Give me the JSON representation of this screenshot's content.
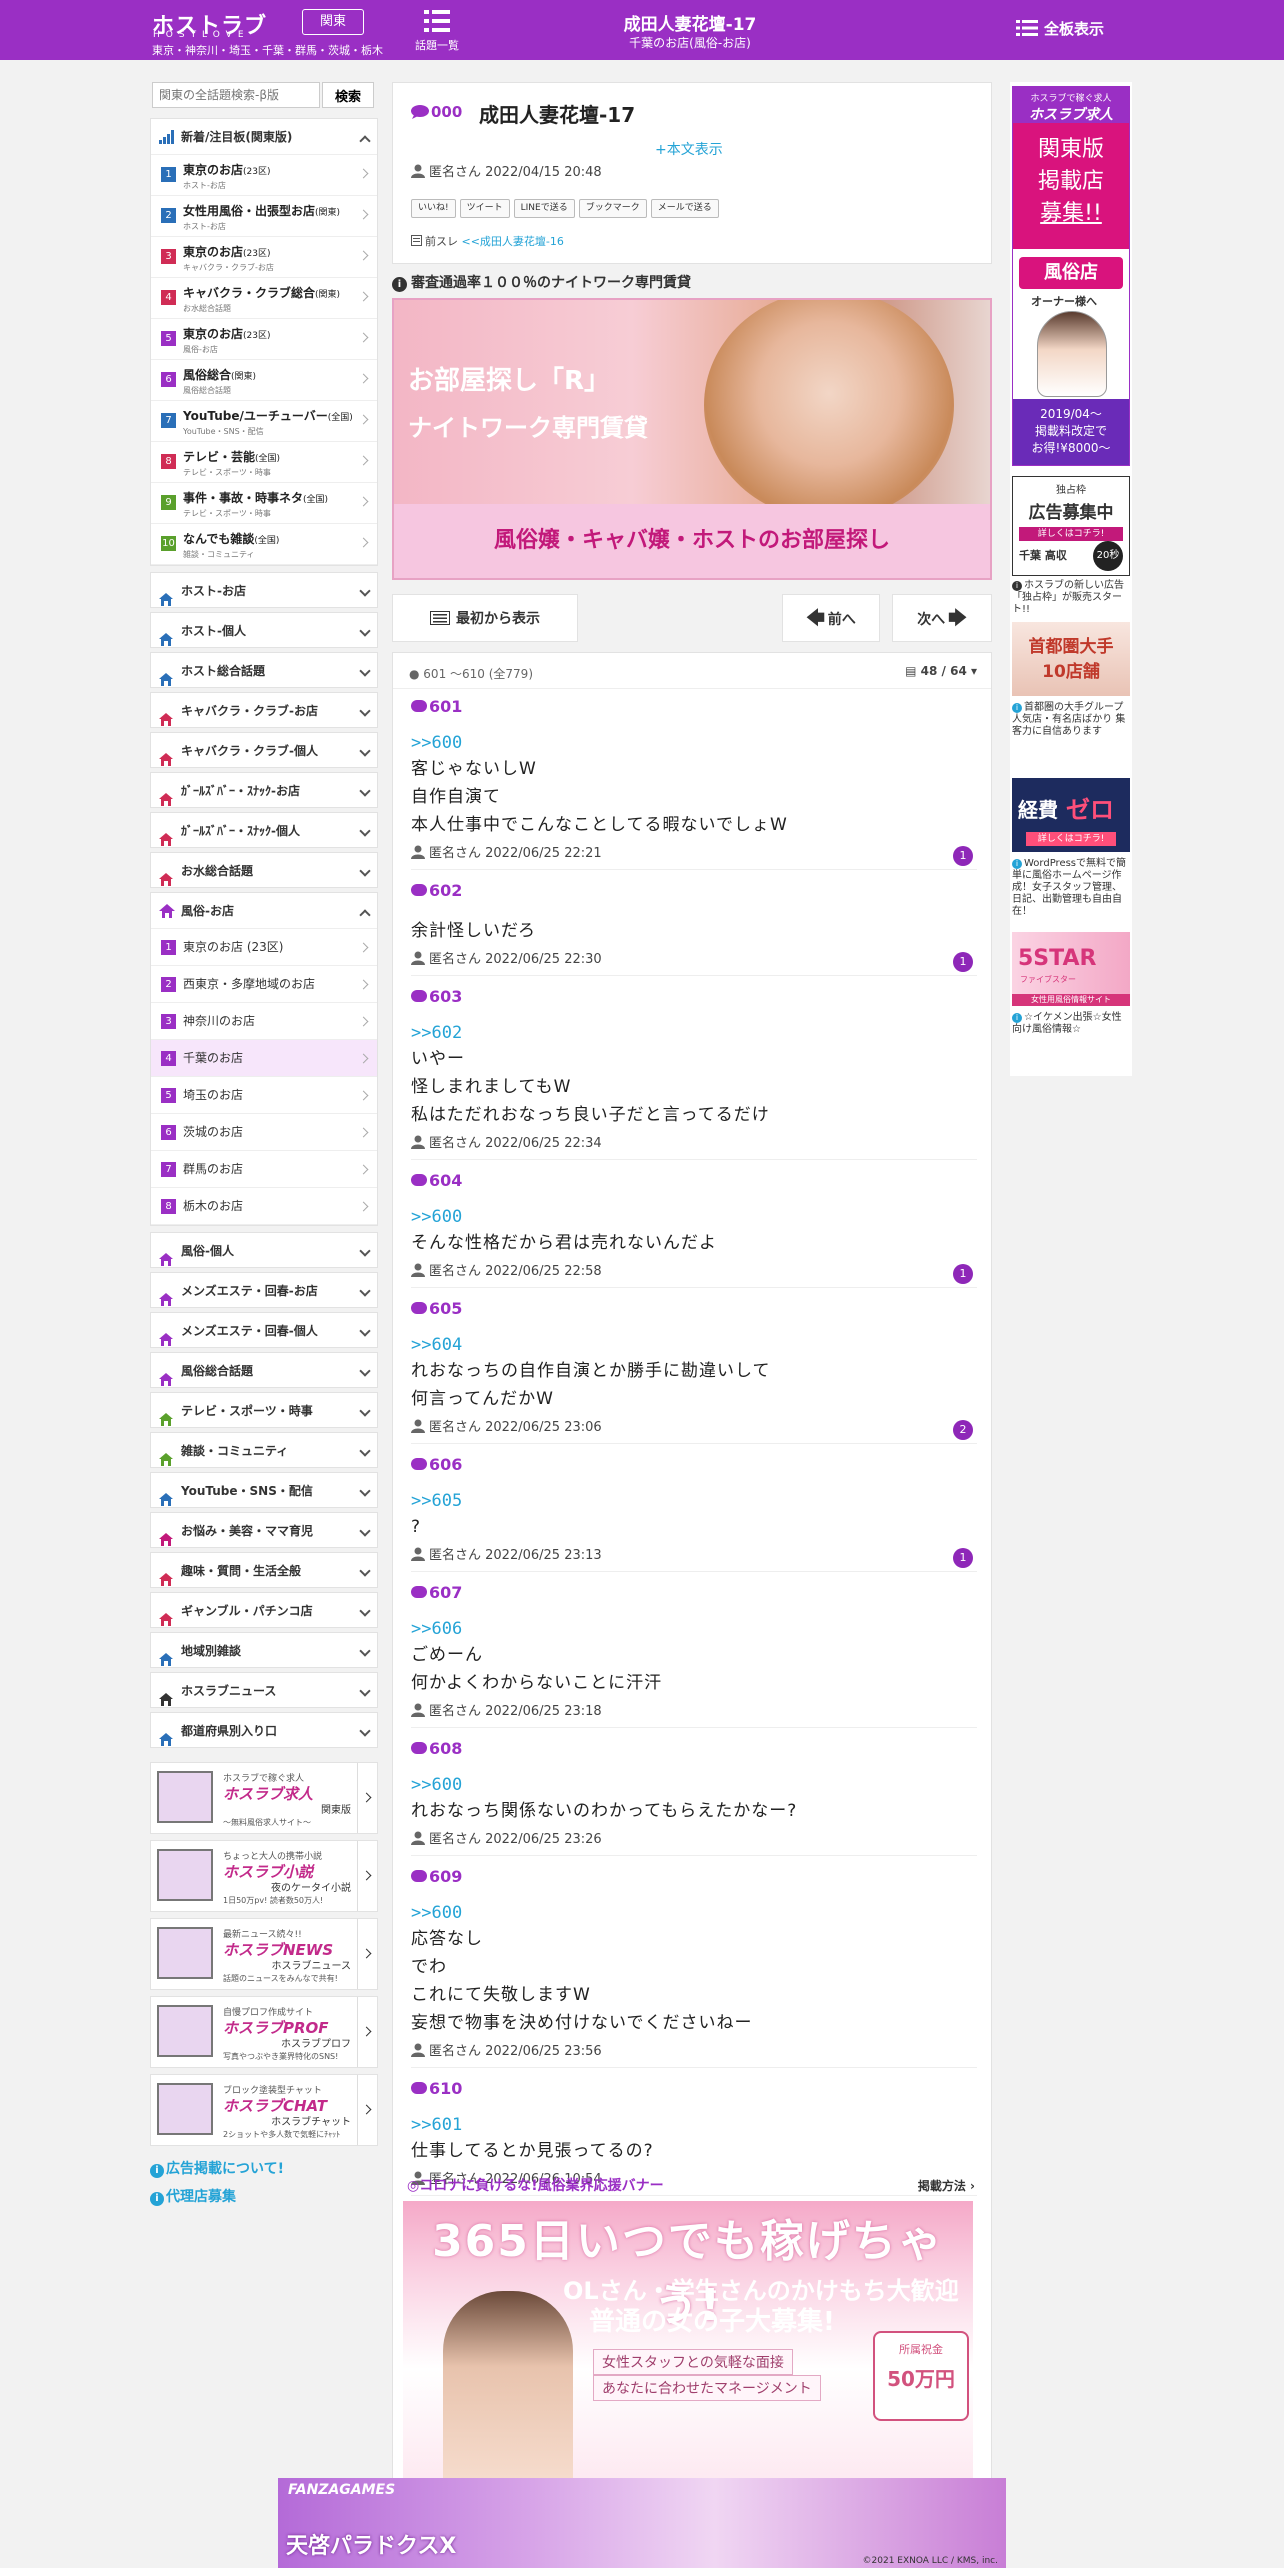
{
  "header": {
    "logo": "ホストラブ",
    "logo_sub": "HOSTLOVE",
    "region_button": "関東",
    "region_list": "東京・神奈川・埼玉・千葉・群馬・茨城・栃木",
    "topics_label": "話題一覧",
    "title": "成田人妻花壇-17",
    "subtitle": "千葉のお店(風俗-お店)",
    "all_boards": "全板表示"
  },
  "search": {
    "placeholder": "関東の全話題検索-β版",
    "button": "検索"
  },
  "sidebar": {
    "new_header": "新着/注目板(関東版)",
    "new_items": [
      {
        "num": "1",
        "title": "東京のお店",
        "tag": "(23区)",
        "sub": "ホスト-お店",
        "color": "#2a6fb8"
      },
      {
        "num": "2",
        "title": "女性用風俗・出張型お店",
        "tag": "(関東)",
        "sub": "ホスト-お店",
        "color": "#2a6fb8"
      },
      {
        "num": "3",
        "title": "東京のお店",
        "tag": "(23区)",
        "sub": "キャバクラ・クラブ-お店",
        "color": "#d02c55"
      },
      {
        "num": "4",
        "title": "キャバクラ・クラブ総合",
        "tag": "(関東)",
        "sub": "お水総合話題",
        "color": "#d02c55"
      },
      {
        "num": "5",
        "title": "東京のお店",
        "tag": "(23区)",
        "sub": "風俗-お店",
        "color": "#9a2fc4"
      },
      {
        "num": "6",
        "title": "風俗総合",
        "tag": "(関東)",
        "sub": "風俗総合話題",
        "color": "#9a2fc4"
      },
      {
        "num": "7",
        "title": "YouTube/ユーチューバー",
        "tag": "(全国)",
        "sub": "YouTube・SNS・配信",
        "color": "#2a6fb8"
      },
      {
        "num": "8",
        "title": "テレビ・芸能",
        "tag": "(全国)",
        "sub": "テレビ・スポーツ・時事",
        "color": "#d02c55"
      },
      {
        "num": "9",
        "title": "事件・事故・時事ネタ",
        "tag": "(全国)",
        "sub": "テレビ・スポーツ・時事",
        "color": "#5aa02c"
      },
      {
        "num": "10",
        "title": "なんでも雑談",
        "tag": "(全国)",
        "sub": "雑談・コミュニティ",
        "color": "#5aa02c"
      }
    ],
    "cats_a": [
      "ホスト-お店",
      "ホスト-個人",
      "ホスト総合話題",
      "キャバクラ・クラブ-お店",
      "キャバクラ・クラブ-個人",
      "ｶﾞｰﾙｽﾞﾊﾞｰ・ｽﾅｯｸ-お店",
      "ｶﾞｰﾙｽﾞﾊﾞｰ・ｽﾅｯｸ-個人",
      "お水総合話題"
    ],
    "fuzoku_header": "風俗-お店",
    "fuzoku_items": [
      "東京のお店 (23区)",
      "西東京・多摩地域のお店",
      "神奈川のお店",
      "千葉のお店",
      "埼玉のお店",
      "茨城のお店",
      "群馬のお店",
      "栃木のお店"
    ],
    "cats_b": [
      "風俗-個人",
      "メンズエステ・回春-お店",
      "メンズエステ・回春-個人",
      "風俗総合話題",
      "テレビ・スポーツ・時事",
      "雑談・コミュニティ",
      "YouTube・SNS・配信",
      "お悩み・美容・ママ育児",
      "趣味・質問・生活全般",
      "ギャンブル・パチンコ店",
      "地域別雑談",
      "ホスラブニュース",
      "都道府県別入り口"
    ],
    "promos": [
      {
        "top": "ホスラブで稼ぐ求人",
        "name": "ホスラブ求人",
        "right": "関東版",
        "desc": "〜無料風俗求人サイト〜"
      },
      {
        "top": "ちょっと大人の携帯小説",
        "name": "ホスラブ小説",
        "right": "夜のケータイ小説",
        "desc": "1日50万pv! 読者数50万人!"
      },
      {
        "top": "最新ニュース続々!!",
        "name": "ホスラブNEWS",
        "right": "ホスラブニュース",
        "desc": "話題のニュースをみんなで共有!"
      },
      {
        "top": "自慢プロフ作成サイト",
        "name": "ホスラブPROF",
        "right": "ホスラブプロフ",
        "desc": "写真やつぶやき業界特化のSNS!"
      },
      {
        "top": "ブロック塗装型チャット",
        "name": "ホスラブCHAT",
        "right": "ホスラブチャット",
        "desc": "2ショットや多人数で気軽にﾁｬｯﾄ"
      }
    ],
    "link_ad": "広告掲載について!",
    "link_agency": "代理店募集"
  },
  "thread": {
    "num": "000",
    "title": "成田人妻花壇-17",
    "show_body": "+本文表示",
    "meta": "匿名さん 2022/04/15 20:48",
    "shares": [
      "いいね!",
      "ツイート",
      "LINEで送る",
      "ブックマーク",
      "メールで送る"
    ],
    "prev_label": "前スレ",
    "prev_link": "<<成田人妻花壇-16"
  },
  "ad_top": {
    "label": "審査通過率１００％のナイトワーク専門賃貸",
    "line1": "お部屋探し「R」",
    "line2": "ナイトワーク専門賃貸",
    "line3": "風俗嬢・キャバ嬢・ホストのお部屋探し"
  },
  "nav": {
    "first": "最初から表示",
    "prev": "前へ",
    "next": "次へ"
  },
  "posts_header": {
    "range": "601 〜610 (全779)",
    "page": "48 / 64"
  },
  "posts": [
    {
      "no": "601",
      "ref": ">>600",
      "lines": [
        "客じゃないしW",
        "自作自演て",
        "本人仕事中でこんなことしてる暇ないでしょW"
      ],
      "meta": "匿名さん 2022/06/25 22:21",
      "badge": "1"
    },
    {
      "no": "602",
      "ref": "",
      "lines": [
        "余計怪しいだろ"
      ],
      "meta": "匿名さん 2022/06/25 22:30",
      "badge": "1"
    },
    {
      "no": "603",
      "ref": ">>602",
      "lines": [
        "いやー",
        "怪しまれましてもW",
        "私はただれおなっち良い子だと言ってるだけ"
      ],
      "meta": "匿名さん 2022/06/25 22:34",
      "badge": ""
    },
    {
      "no": "604",
      "ref": ">>600",
      "lines": [
        "そんな性格だから君は売れないんだよ"
      ],
      "meta": "匿名さん 2022/06/25 22:58",
      "badge": "1"
    },
    {
      "no": "605",
      "ref": ">>604",
      "lines": [
        "れおなっちの自作自演とか勝手に勘違いして",
        "何言ってんだかW"
      ],
      "meta": "匿名さん 2022/06/25 23:06",
      "badge": "2"
    },
    {
      "no": "606",
      "ref": ">>605",
      "lines": [
        "?"
      ],
      "meta": "匿名さん 2022/06/25 23:13",
      "badge": "1"
    },
    {
      "no": "607",
      "ref": ">>606",
      "lines": [
        "ごめーん",
        "何かよくわからないことに汗汗"
      ],
      "meta": "匿名さん 2022/06/25 23:18",
      "badge": ""
    },
    {
      "no": "608",
      "ref": ">>600",
      "lines": [
        "れおなっち関係ないのわかってもらえたかなー?"
      ],
      "meta": "匿名さん 2022/06/25 23:26",
      "badge": ""
    },
    {
      "no": "609",
      "ref": ">>600",
      "lines": [
        "応答なし",
        "でわ",
        "これにて失敬しますW",
        "妄想で物事を決め付けないでくださいねー"
      ],
      "meta": "匿名さん 2022/06/25 23:56",
      "badge": ""
    },
    {
      "no": "610",
      "ref": ">>601",
      "lines": [
        "仕事してるとか見張ってるの?"
      ],
      "meta": "匿名さん 2022/06/26 10:54",
      "badge": ""
    }
  ],
  "corona": {
    "label": "◎コロナに負けるな!風俗業界応援バナー",
    "howto": "掲載方法"
  },
  "ad_bottom": {
    "big": "365日いつでも稼げちゃう!",
    "l2": "OLさん・学生さんのかけもち大歓迎",
    "l3": "普通の女の子大募集!",
    "l4": "女性スタッフとの気軽な面接",
    "l5": "あなたに合わせたマネージメント",
    "prize_top": "所属祝金",
    "prize": "50万円"
  },
  "right_ads": [
    {
      "h1": "ホスラブで稼ぐ求人",
      "h2": "ホスラブ求人",
      "h3": "関東版",
      "h4": "掲載店",
      "h5": "募集!!",
      "h6": "風俗店",
      "h7": "オーナー様へ",
      "h8": "2019/04〜",
      "h9": "掲載料改定で",
      "h10": "お得!¥8000〜"
    },
    {
      "t1": "独占枠",
      "t2": "広告募集中",
      "t3": "詳しくはコチラ!",
      "t4": "千葉 高収",
      "t5": "20秒",
      "cap": "ホスラブの新しい広告「独占枠」が販売スタート!!"
    },
    {
      "t1": "首都圏大手",
      "t2": "10店舗",
      "cap": "首都圏の大手グループ 人気店・有名店ばかり 集客力に自信あります"
    },
    {
      "t1": "経費",
      "t2": "ゼロ",
      "t3": "詳しくはコチラ!",
      "cap": "WordPressで無料で簡単に風俗ホームページ作成！女子スタッフ管理、日記、出勤管理も自由自在！"
    },
    {
      "t1": "5STAR",
      "t2": "ファイブスター",
      "t3": "女性用風俗情報サイト",
      "cap": "☆イケメン出張☆女性向け風俗情報☆"
    }
  ],
  "footer_ad": {
    "brand": "FANZAGAMES",
    "title": "天啓パラドクスX",
    "copy": "©2021 EXNOA LLC / KMS, inc."
  },
  "colors": {
    "brand": "#9a2fc4",
    "link": "#24a3d6"
  }
}
